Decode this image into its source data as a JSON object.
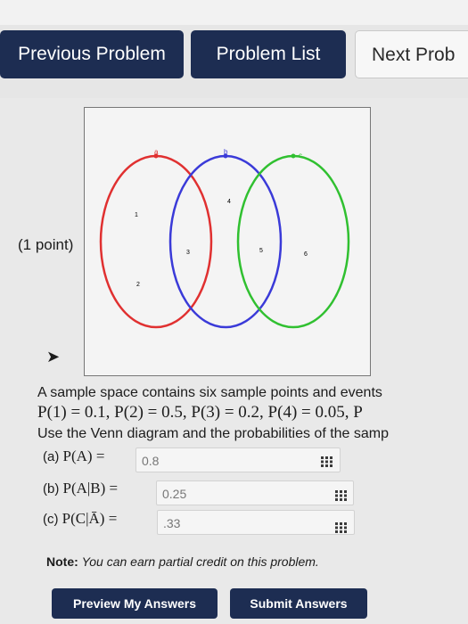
{
  "nav": {
    "previous": "Previous Problem",
    "list": "Problem List",
    "next": "Next Prob"
  },
  "problem": {
    "points": "(1 point)",
    "intro": "A sample space contains six sample points and events",
    "probabilities": "P(1) = 0.1, P(2) = 0.5, P(3) = 0.2, P(4) = 0.05, P",
    "instruction": "Use the Venn diagram and the probabilities of the samp"
  },
  "venn": {
    "circles": [
      {
        "label": "a",
        "color": "#e03030"
      },
      {
        "label": "b",
        "color": "#3a3ad8"
      },
      {
        "label": "c",
        "color": "#30c030"
      }
    ],
    "points": [
      "1",
      "2",
      "3",
      "4",
      "5",
      "6"
    ]
  },
  "answers": [
    {
      "prefix": "(a)",
      "expression": "P(A) =",
      "value": "0.8"
    },
    {
      "prefix": "(b)",
      "expression": "P(A|B) =",
      "value": "0.25"
    },
    {
      "prefix": "(c)",
      "expression": "P(C|Ā) =",
      "value": ".33"
    }
  ],
  "note": {
    "label": "Note:",
    "text": "You can earn partial credit on this problem."
  },
  "buttons": {
    "preview": "Preview My Answers",
    "submit": "Submit Answers"
  },
  "icons": {
    "cursor": "mouse-pointer-icon",
    "input_helper": "grid-icon"
  }
}
